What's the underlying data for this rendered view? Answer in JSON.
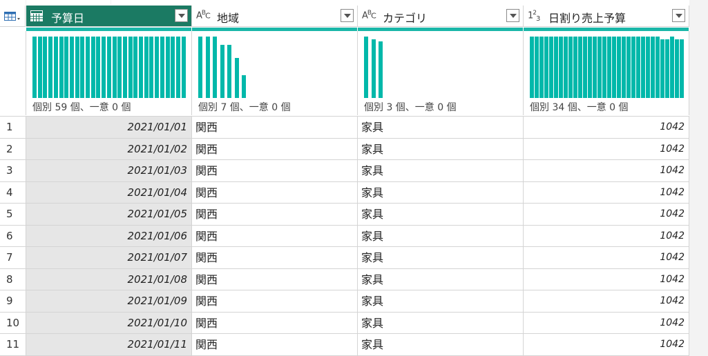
{
  "table_menu_icon": "table-menu-icon",
  "columns": [
    {
      "name": "予算日",
      "type_icon": "calendar-table-icon",
      "type_label": "",
      "stat": "個別 59 個、一意 0 個",
      "distribution": [
        1,
        1,
        1,
        1,
        1,
        1,
        1,
        1,
        1,
        1,
        1,
        1,
        1,
        1,
        1,
        1,
        1,
        1,
        1,
        1,
        1,
        1,
        1,
        1,
        1,
        1,
        1,
        1,
        1
      ]
    },
    {
      "name": "地域",
      "type_icon": "text-type-icon",
      "type_label": "ABC",
      "stat": "個別 7 個、一意 0 個",
      "distribution": [
        1,
        1,
        1,
        0.87,
        0.87,
        0.65,
        0.37
      ]
    },
    {
      "name": "カテゴリ",
      "type_icon": "text-type-icon",
      "type_label": "ABC",
      "stat": "個別 3 個、一意 0 個",
      "distribution": [
        1,
        0.95,
        0.92
      ]
    },
    {
      "name": "日割り売上予算",
      "type_icon": "number-type-icon",
      "type_label": "123",
      "stat": "個別 34 個、一意 0 個",
      "distribution": [
        1,
        1,
        1,
        1,
        1,
        1,
        1,
        1,
        1,
        1,
        1,
        1,
        1,
        1,
        1,
        1,
        1,
        1,
        1,
        1,
        1,
        1,
        1,
        1,
        1,
        1,
        1,
        0.95,
        0.95,
        1,
        0.95,
        0.95
      ]
    }
  ],
  "rows": [
    {
      "n": "1",
      "date": "2021/01/01",
      "region": "関西",
      "category": "家具",
      "budget": "1042"
    },
    {
      "n": "2",
      "date": "2021/01/02",
      "region": "関西",
      "category": "家具",
      "budget": "1042"
    },
    {
      "n": "3",
      "date": "2021/01/03",
      "region": "関西",
      "category": "家具",
      "budget": "1042"
    },
    {
      "n": "4",
      "date": "2021/01/04",
      "region": "関西",
      "category": "家具",
      "budget": "1042"
    },
    {
      "n": "5",
      "date": "2021/01/05",
      "region": "関西",
      "category": "家具",
      "budget": "1042"
    },
    {
      "n": "6",
      "date": "2021/01/06",
      "region": "関西",
      "category": "家具",
      "budget": "1042"
    },
    {
      "n": "7",
      "date": "2021/01/07",
      "region": "関西",
      "category": "家具",
      "budget": "1042"
    },
    {
      "n": "8",
      "date": "2021/01/08",
      "region": "関西",
      "category": "家具",
      "budget": "1042"
    },
    {
      "n": "9",
      "date": "2021/01/09",
      "region": "関西",
      "category": "家具",
      "budget": "1042"
    },
    {
      "n": "10",
      "date": "2021/01/10",
      "region": "関西",
      "category": "家具",
      "budget": "1042"
    },
    {
      "n": "11",
      "date": "2021/01/11",
      "region": "関西",
      "category": "家具",
      "budget": "1042"
    }
  ],
  "colors": {
    "selected_header": "#1b7a63",
    "quality_bar": "#1ab7a8",
    "distribution_bar": "#01b8aa",
    "selected_column_bg": "#e6e6e6"
  }
}
